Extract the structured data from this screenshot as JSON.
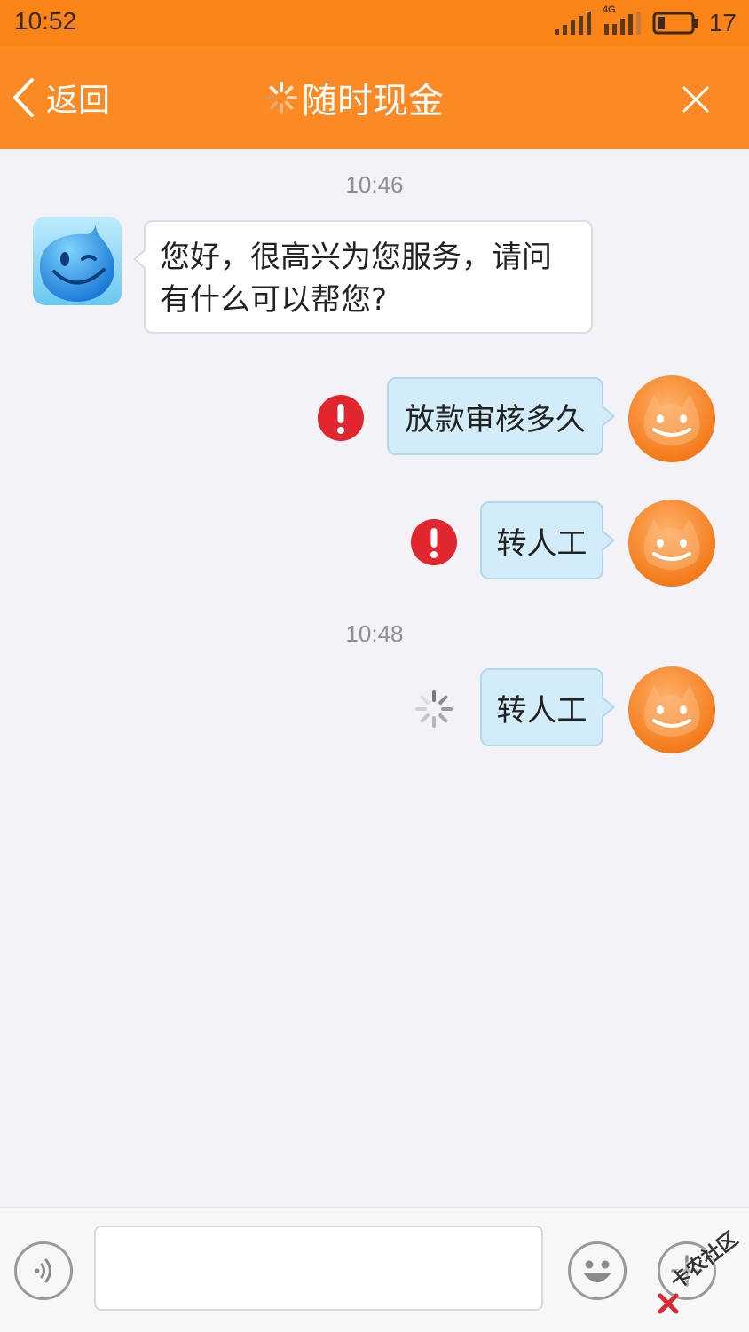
{
  "status_bar": {
    "time": "10:52",
    "network": "4G",
    "battery": "17"
  },
  "nav": {
    "back_label": "返回",
    "title": "随时现金"
  },
  "chat": {
    "messages": [
      {
        "type": "timestamp",
        "text": "10:46"
      },
      {
        "type": "incoming",
        "sender": "agent",
        "text_line1": "您好，很高兴为您服务，请问",
        "text_line2": "有什么可以帮您?"
      },
      {
        "type": "outgoing",
        "text": "放款审核多久",
        "status": "failed"
      },
      {
        "type": "outgoing",
        "text": "转人工",
        "status": "failed"
      },
      {
        "type": "timestamp",
        "text": "10:48"
      },
      {
        "type": "outgoing",
        "text": "转人工",
        "status": "sending"
      }
    ]
  },
  "input_bar": {
    "voice_icon": "voice-icon",
    "emoji_icon": "emoji-icon",
    "add_icon": "plus-icon",
    "input_value": ""
  },
  "watermark": {
    "text": "卡农社区"
  },
  "colors": {
    "header_orange": "#fb8a24",
    "status_orange": "#f98418",
    "outgoing_bubble": "#d3ecfa",
    "error_red": "#e0262e",
    "avatar_orange": "#f67e12"
  }
}
